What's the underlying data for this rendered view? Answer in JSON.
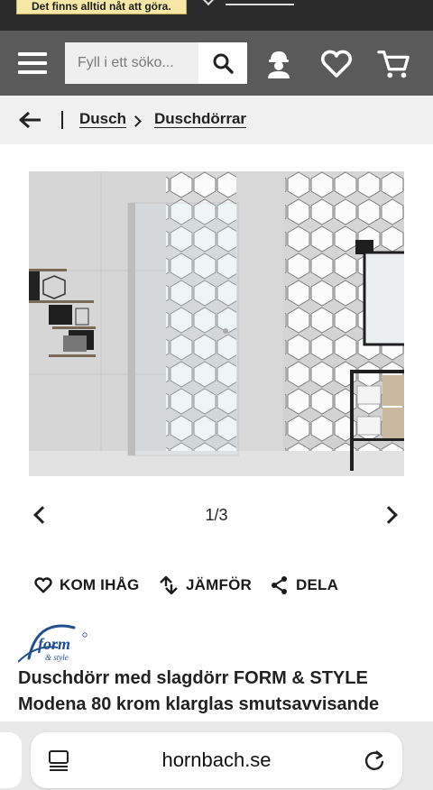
{
  "promo": {
    "text": "Det finns alltid nåt att göra."
  },
  "header": {
    "search": {
      "placeholder": "Fyll i ett söko..."
    },
    "icons": [
      "menu-icon",
      "search-icon",
      "account-icon",
      "wishlist-heart-icon",
      "cart-icon"
    ],
    "background": "#5a5a5a"
  },
  "breadcrumb": {
    "items": [
      {
        "label": "Dusch"
      },
      {
        "label": "Duschdörrar"
      }
    ]
  },
  "gallery": {
    "counter": "1/3",
    "current": 1,
    "total": 3
  },
  "actions": {
    "remember": "KOM IHÅG",
    "compare": "JÄMFÖR",
    "share": "DELA"
  },
  "product": {
    "brand_logo_text": "form & style",
    "title": "Duschdörr med slagdörr FORM & STYLE Modena 80 krom klarglas smutsavvisande",
    "accent_color": "#1f4f8f"
  },
  "browser": {
    "url": "hornbach.se"
  }
}
